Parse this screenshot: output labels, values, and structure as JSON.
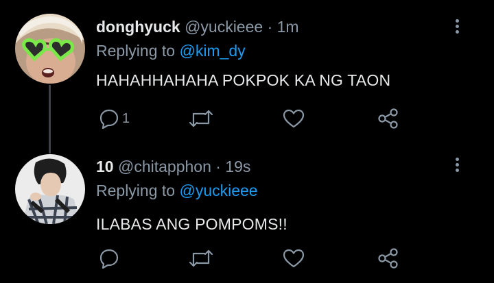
{
  "tweets": [
    {
      "display_name": "donghyuck",
      "handle": "@yuckieee",
      "separator": "·",
      "time": "1m",
      "replying_prefix": "Replying to",
      "replying_to": "@kim_dy",
      "text": "HAHAHHAHAHA POKPOK KA NG TAON",
      "reply_count": "1",
      "avatar_icon": "profile-photo-green-heart-sunglasses"
    },
    {
      "display_name": "10",
      "handle": "@chitapphon",
      "separator": "·",
      "time": "19s",
      "replying_prefix": "Replying to",
      "replying_to": "@yuckieee",
      "text": "ILABAS ANG POMPOMS!!",
      "reply_count": "",
      "avatar_icon": "profile-photo-person-plaid-shirt"
    }
  ],
  "colors": {
    "background": "#000000",
    "text_primary": "#e7e9ea",
    "text_secondary": "#8b98a5",
    "link": "#1d9bf0",
    "thread_line": "#3d4248"
  }
}
